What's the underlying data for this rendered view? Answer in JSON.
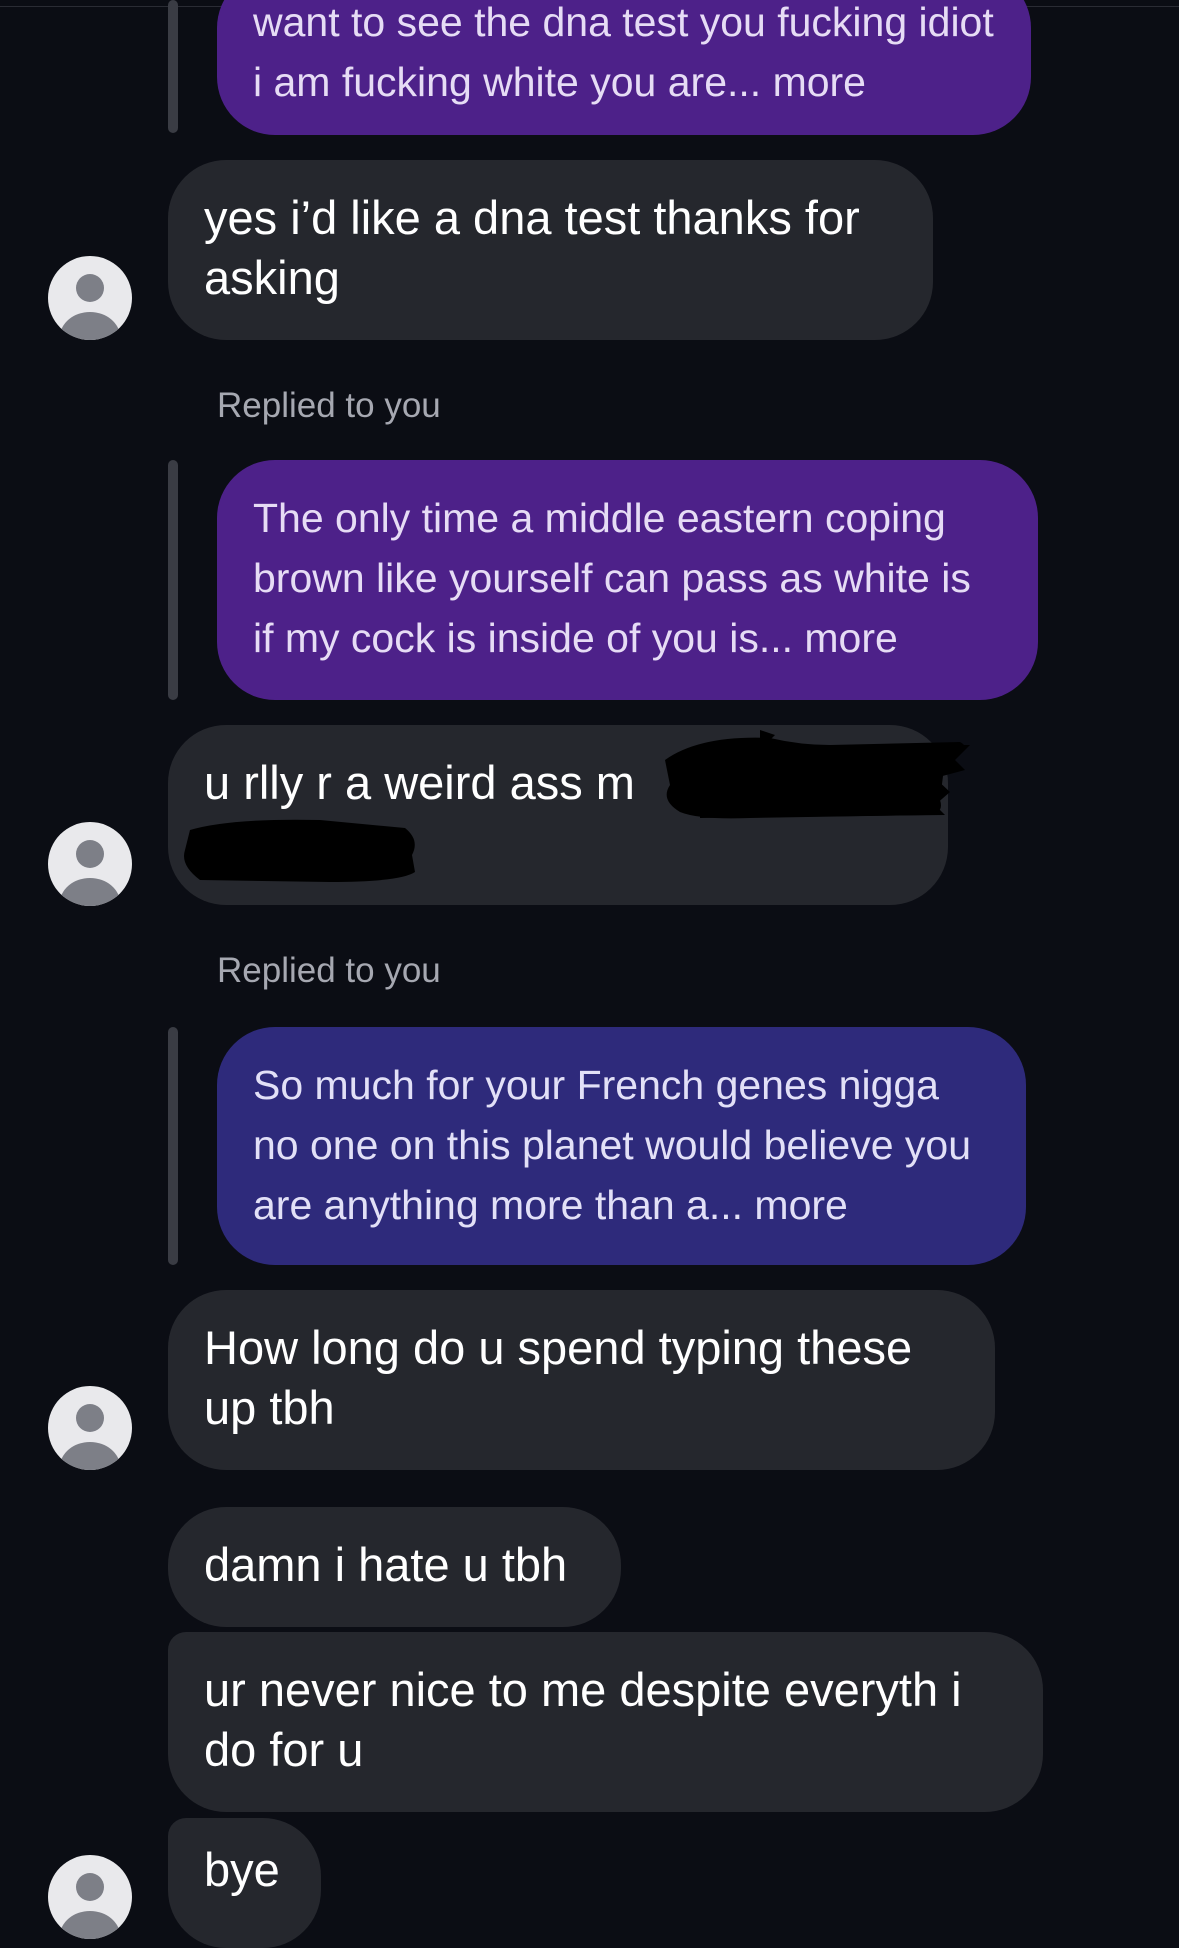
{
  "conversation": {
    "messages": [
      {
        "type": "quoted",
        "text": "want to see the dna test you fucking idiot i am fucking white you are... more"
      },
      {
        "type": "received",
        "text": "yes i’d like a dna test thanks for asking"
      },
      {
        "type": "replied_label",
        "text": "Replied to you"
      },
      {
        "type": "quoted",
        "text": "The only time a middle eastern coping brown like yourself can pass as white is if my cock is inside of you is... more"
      },
      {
        "type": "received",
        "text": "u rlly r a weird ass m"
      },
      {
        "type": "replied_label",
        "text": "Replied to you"
      },
      {
        "type": "quoted",
        "text": "So much for your French genes nigga no one on this planet would believe you are anything more than a... more"
      },
      {
        "type": "received",
        "text": "How long do u spend typing these up tbh"
      },
      {
        "type": "received",
        "text": "damn i hate u tbh"
      },
      {
        "type": "received",
        "text": "ur never nice to me despite everyth i do for u"
      },
      {
        "type": "received",
        "text": "bye"
      }
    ]
  },
  "colors": {
    "background": "#0b0d14",
    "received_bubble": "#25272d",
    "quoted_bubble_purple": "#4d2189",
    "quoted_bubble_indigo": "#2e2a7b",
    "label_text": "#a6a8b1"
  },
  "icons": {
    "avatar": "default-user-avatar-icon",
    "redaction": "black-scribble-redaction"
  }
}
